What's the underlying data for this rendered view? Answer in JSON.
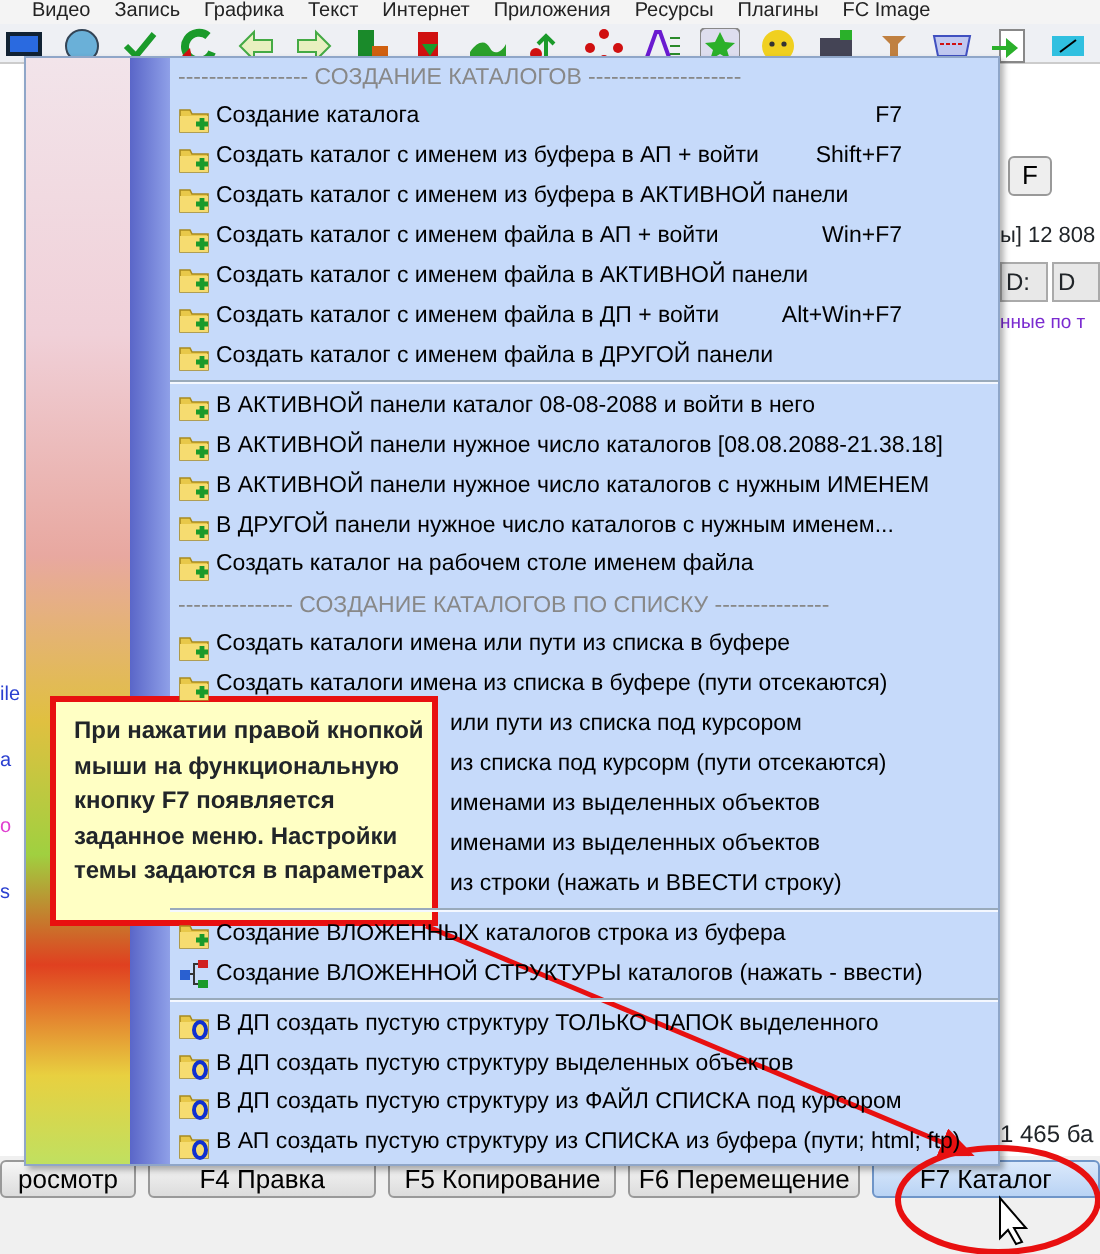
{
  "menubar": [
    "Видео",
    "Запись",
    "Графика",
    "Текст",
    "Интернет",
    "Приложения",
    "Ресурсы",
    "Плагины",
    "FC Image"
  ],
  "left_edge": [
    {
      "text": "ile",
      "color": "#2a3fd0"
    },
    {
      "text": "a",
      "color": "#2a3fd0"
    },
    {
      "text": "o",
      "color": "#e040d0"
    },
    {
      "text": "s",
      "color": "#2a3fd0"
    }
  ],
  "right_panel": {
    "drive_button": "F",
    "info": "ы] 12 808",
    "drive_tabs": [
      "D:",
      "D"
    ],
    "path_text": "нные по т",
    "status": "1 465 ба"
  },
  "menu": {
    "items": [
      {
        "kind": "header",
        "text": "----------------- СОЗДАНИЕ КАТАЛОГОВ --------------------"
      },
      {
        "kind": "item",
        "text": "Создание каталога",
        "shortcut": "F7"
      },
      {
        "kind": "item",
        "text": "Создать каталог с именем из буфера в АП + войти",
        "shortcut": "Shift+F7"
      },
      {
        "kind": "item",
        "text": "Создать каталог с именем из буфера в АКТИВНОЙ панели"
      },
      {
        "kind": "item",
        "text": "Создать каталог с именем файла в АП + войти",
        "shortcut": "Win+F7"
      },
      {
        "kind": "item",
        "text": "Создать каталог с именем файла в АКТИВНОЙ панели"
      },
      {
        "kind": "item",
        "text": "Создать каталог с именем файла в ДП + войти",
        "shortcut": "Alt+Win+F7"
      },
      {
        "kind": "item",
        "text": "Создать каталог с именем файла в ДРУГОЙ панели"
      },
      {
        "kind": "separator"
      },
      {
        "kind": "item",
        "text": "В АКТИВНОЙ панели каталог 08-08-2088 и войти в него"
      },
      {
        "kind": "item",
        "text": "В АКТИВНОЙ панели нужное число каталогов [08.08.2088-21.38.18]"
      },
      {
        "kind": "item",
        "text": "В АКТИВНОЙ панели нужное число каталогов с нужным ИМЕНЕМ"
      },
      {
        "kind": "item",
        "text": "В ДРУГОЙ панели нужное число каталогов с нужным именем..."
      },
      {
        "kind": "item",
        "text": "Создать каталог на рабочем столе именем файла"
      },
      {
        "kind": "header",
        "text": "--------------- СОЗДАНИЕ КАТАЛОГОВ  ПО СПИСКУ ---------------"
      },
      {
        "kind": "item",
        "text": "Создать каталоги имена или пути из списка в буфере"
      },
      {
        "kind": "item",
        "text": "Создать каталоги имена из списка в буфере (пути отсекаются)"
      },
      {
        "kind": "covered",
        "text": "или пути из списка под курсором"
      },
      {
        "kind": "covered",
        "text": "из списка под курсорм (пути отсекаются)"
      },
      {
        "kind": "covered",
        "text": "именами из выделенных объектов"
      },
      {
        "kind": "covered",
        "text": "именами из выделенных объектов"
      },
      {
        "kind": "covered",
        "text": "из строки (нажать и ВВЕСТИ строку)"
      },
      {
        "kind": "separator"
      },
      {
        "kind": "item",
        "text": "Создание ВЛОЖЕННЫХ каталогов строка из буфера"
      },
      {
        "kind": "tree-item",
        "text": "Создание ВЛОЖЕННОЙ СТРУКТУРЫ каталогов (нажать - ввести)"
      },
      {
        "kind": "separator"
      },
      {
        "kind": "structure-item",
        "text": "В ДП создать пустую структуру ТОЛЬКО ПАПОК выделенного"
      },
      {
        "kind": "structure-item",
        "text": "В ДП создать пустую структуру выделенных объектов"
      },
      {
        "kind": "structure-item",
        "text": "В ДП создать пустую структуру из ФАЙЛ СПИСКА под курсором"
      },
      {
        "kind": "structure-item",
        "text": "В АП создать пустую структуру из СПИСКА из буфера (пути; html; ftp)"
      }
    ]
  },
  "callout": {
    "text": "При нажатии правой кнопкой мыши на функциональную кнопку F7 появляется заданное меню. Настройки темы задаются в параметрах"
  },
  "function_keys": [
    {
      "label": "росмотр",
      "selected": false
    },
    {
      "label": "F4 Правка",
      "selected": false
    },
    {
      "label": "F5 Копирование",
      "selected": false
    },
    {
      "label": "F6 Перемещение",
      "selected": false
    },
    {
      "label": "F7 Каталог",
      "selected": true
    }
  ]
}
